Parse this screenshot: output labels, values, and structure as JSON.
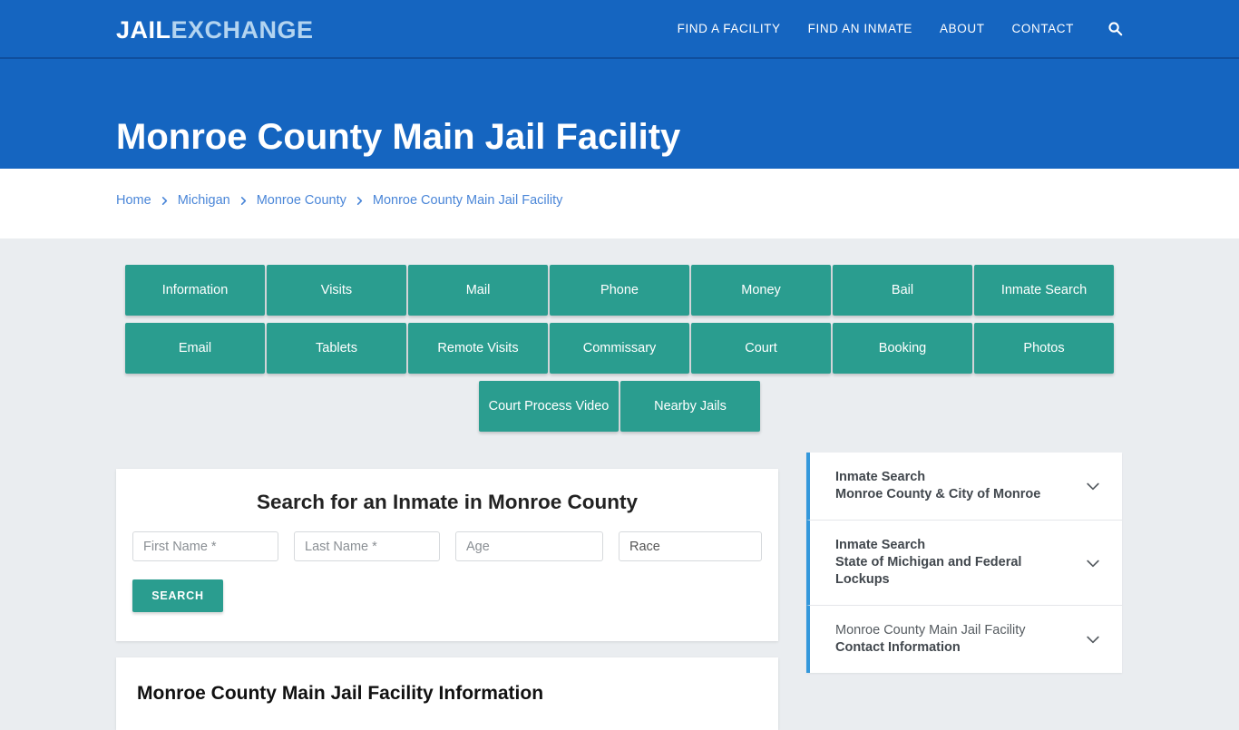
{
  "colors": {
    "header_blue": "#1565c0",
    "teal": "#2a9d8f",
    "accent_blue": "#3498db",
    "link_blue": "#4a86d8",
    "page_bg": "#eaedf0"
  },
  "header": {
    "logo_part1": "JAIL",
    "logo_part2": "EXCHANGE",
    "nav": [
      {
        "label": "FIND A FACILITY",
        "name": "nav-find-a-facility"
      },
      {
        "label": "FIND AN INMATE",
        "name": "nav-find-an-inmate"
      },
      {
        "label": "ABOUT",
        "name": "nav-about"
      },
      {
        "label": "CONTACT",
        "name": "nav-contact"
      }
    ],
    "search_icon": "search-icon"
  },
  "title_band": {
    "title": "Monroe County Main Jail Facility"
  },
  "breadcrumb": {
    "separator_icon": "chevron-right-icon",
    "items": [
      {
        "label": "Home"
      },
      {
        "label": "Michigan"
      },
      {
        "label": "Monroe County"
      },
      {
        "label": "Monroe County Main Jail Facility"
      }
    ]
  },
  "button_grid": {
    "row1": [
      {
        "label": "Information"
      },
      {
        "label": "Visits"
      },
      {
        "label": "Mail"
      },
      {
        "label": "Phone"
      },
      {
        "label": "Money"
      },
      {
        "label": "Bail"
      },
      {
        "label": "Inmate Search"
      }
    ],
    "row2": [
      {
        "label": "Email"
      },
      {
        "label": "Tablets"
      },
      {
        "label": "Remote Visits"
      },
      {
        "label": "Commissary"
      },
      {
        "label": "Court"
      },
      {
        "label": "Booking"
      },
      {
        "label": "Photos"
      }
    ],
    "row3": [
      {
        "label": "Court Process Video"
      },
      {
        "label": "Nearby Jails"
      }
    ]
  },
  "search_card": {
    "heading": "Search for an Inmate in Monroe County",
    "first_name_placeholder": "First Name *",
    "first_name_value": "",
    "last_name_placeholder": "Last Name *",
    "last_name_value": "",
    "age_placeholder": "Age",
    "age_value": "",
    "race_selected": "Race",
    "search_button": "SEARCH"
  },
  "sidebar": {
    "panels": [
      {
        "line1": "Inmate Search",
        "line2": "Monroe County & City of Monroe",
        "line1_light": false,
        "chevron": "chevron-down-icon"
      },
      {
        "line1": "Inmate Search",
        "line2": "State of Michigan and Federal Lockups",
        "line1_light": false,
        "chevron": "chevron-down-icon"
      },
      {
        "line1": "Monroe County Main Jail Facility",
        "line2": "Contact Information",
        "line1_light": true,
        "chevron": "chevron-down-icon"
      }
    ]
  },
  "info_card": {
    "heading": "Monroe County Main Jail Facility Information"
  }
}
